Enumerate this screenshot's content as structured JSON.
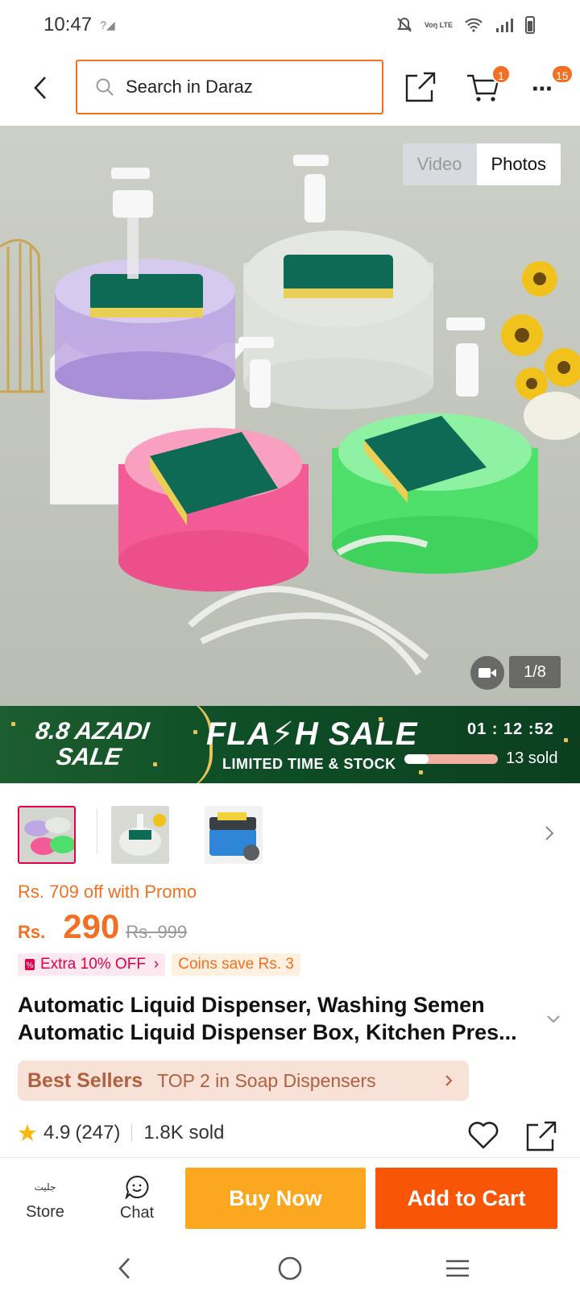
{
  "status_bar": {
    "time": "10:47",
    "signal_label": "Voŋ LTE"
  },
  "header": {
    "search_placeholder": "Search in Daraz",
    "cart_count": "1",
    "more_count": "15"
  },
  "gallery": {
    "tabs": [
      "Video",
      "Photos"
    ],
    "selected_tab": "Photos",
    "counter": "1/8"
  },
  "flash_sale": {
    "event_line1": "8.8 AZADI",
    "event_line2": "SALE",
    "title": "FLA⚡H SALE",
    "subtitle": "LIMITED TIME & STOCK",
    "timer": "01 : 12 :52",
    "sold_text": "13 sold",
    "sold_fraction": 0.26,
    "colors": {
      "background": "#0f4f27",
      "accent": "#e7c35a"
    }
  },
  "thumbnails": {
    "count_shown": 3,
    "active_index": 0
  },
  "price": {
    "promo_text": "Rs. 709 off with Promo",
    "currency": "Rs.",
    "current": "290",
    "original": "Rs. 999"
  },
  "chips": {
    "extra_off": "Extra 10% OFF",
    "coins": "Coins save Rs. 3"
  },
  "product": {
    "title_line1": "Automatic Liquid Dispenser, Washing Semen",
    "title_line2": "Automatic Liquid Dispenser Box, Kitchen Pres..."
  },
  "best_sellers": {
    "logo": "Best Sellers",
    "text": "TOP 2 in Soap Dispensers"
  },
  "rating": {
    "score": "4.9",
    "count": "(247)",
    "sold": "1.8K sold"
  },
  "action_bar": {
    "store_logo_text": "جلیت",
    "store_label": "Store",
    "chat_label": "Chat",
    "buy_now": "Buy Now",
    "add_to_cart": "Add to Cart"
  },
  "colors": {
    "brand_orange": "#f36f21",
    "buy_now": "#fba720",
    "add_to_cart": "#f85606",
    "promo_pink": "#e1004b"
  }
}
